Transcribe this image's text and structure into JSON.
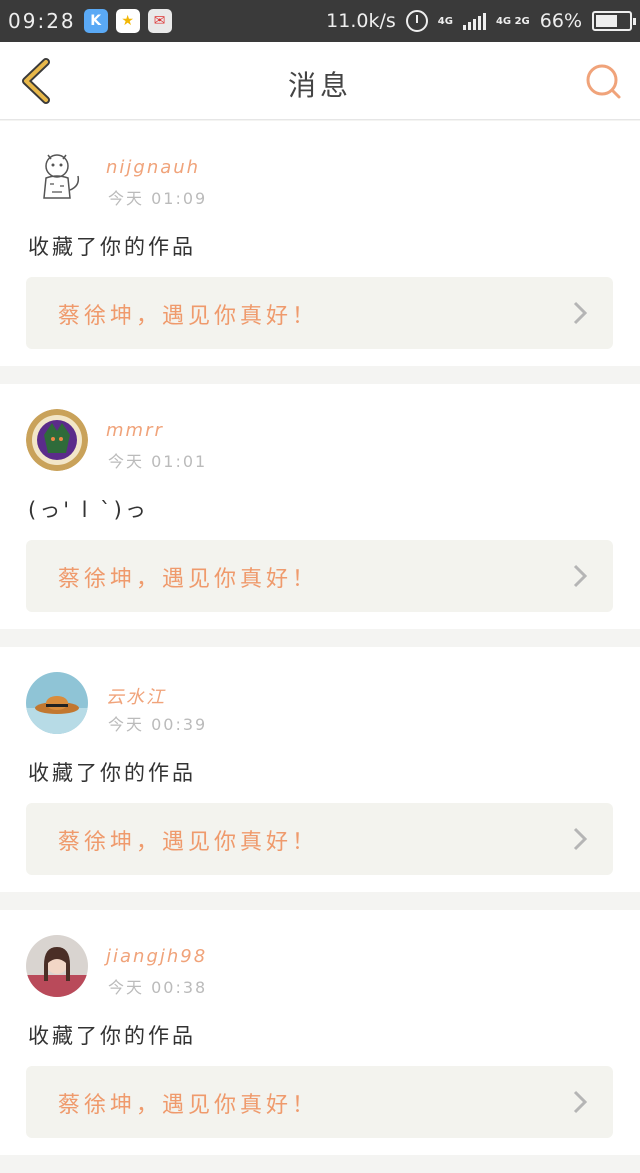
{
  "status_bar": {
    "time": "09:28",
    "speed": "11.0k/s",
    "network": "4G",
    "network2": "4G 2G",
    "battery": "66%",
    "battery_level": 0.66
  },
  "header": {
    "title": "消息"
  },
  "messages": [
    {
      "username": "nijgnauh",
      "time": "今天 01:09",
      "text": "收藏了你的作品",
      "work_title": "蔡徐坤，遇见你真好！"
    },
    {
      "username": "mmrr",
      "time": "今天 01:01",
      "text": "(っ' l `)っ",
      "work_title": "蔡徐坤，遇见你真好！"
    },
    {
      "username": "云水江",
      "time": "今天 00:39",
      "text": "收藏了你的作品",
      "work_title": "蔡徐坤，遇见你真好！"
    },
    {
      "username": "jiangjh98",
      "time": "今天 00:38",
      "text": "收藏了你的作品",
      "work_title": "蔡徐坤，遇见你真好！"
    }
  ],
  "colors": {
    "accent": "#f0a37a",
    "back_arrow": "#e8b84a",
    "search": "#f0a37a"
  }
}
